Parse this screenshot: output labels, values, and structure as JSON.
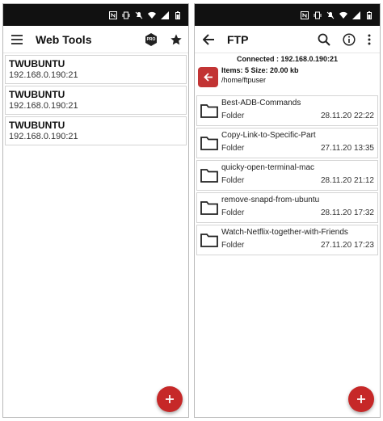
{
  "left": {
    "title": "Web Tools",
    "servers": [
      {
        "name": "TWUBUNTU",
        "address": "192.168.0.190:21"
      },
      {
        "name": "TWUBUNTU",
        "address": "192.168.0.190:21"
      },
      {
        "name": "TWUBUNTU",
        "address": "192.168.0.190:21"
      }
    ],
    "pro_badge": "PRO"
  },
  "right": {
    "title": "FTP",
    "connected": "Connected : 192.168.0.190:21",
    "items_info": "Items: 5 Size: 20.00 kb",
    "path": "/home/ftpuser",
    "files": [
      {
        "name": "Best-ADB-Commands",
        "type": "Folder",
        "date": "28.11.20 22:22"
      },
      {
        "name": "Copy-Link-to-Specific-Part",
        "type": "Folder",
        "date": "27.11.20 13:35"
      },
      {
        "name": "quicky-open-terminal-mac",
        "type": "Folder",
        "date": "28.11.20 21:12"
      },
      {
        "name": "remove-snapd-from-ubuntu",
        "type": "Folder",
        "date": "28.11.20 17:32"
      },
      {
        "name": "Watch-Netflix-together-with-Friends",
        "type": "Folder",
        "date": "27.11.20 17:23"
      }
    ]
  },
  "colors": {
    "accent": "#c62828",
    "statusbar": "#111111",
    "back_button": "#c23434"
  }
}
